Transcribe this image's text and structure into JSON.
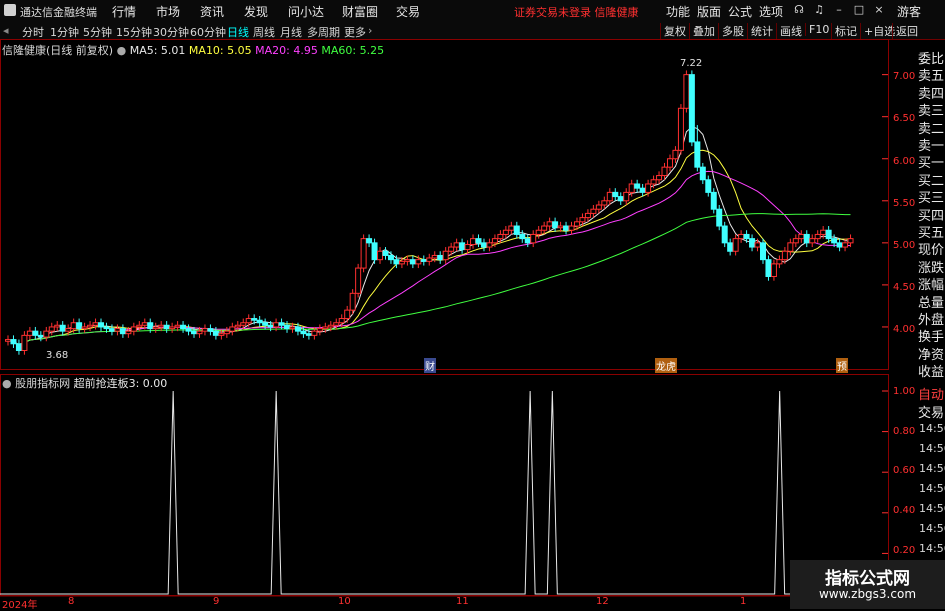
{
  "app": {
    "name": "通达信金融终端"
  },
  "menu": [
    "行情",
    "市场",
    "资讯",
    "发现",
    "问小达",
    "财富圈",
    "交易"
  ],
  "status_alert": "证券交易未登录  信隆健康",
  "top_right": [
    "功能",
    "版面",
    "公式",
    "选项"
  ],
  "guest": "游客",
  "periods": [
    {
      "label": "分时",
      "active": false
    },
    {
      "label": "1分钟",
      "active": false
    },
    {
      "label": "5分钟",
      "active": false
    },
    {
      "label": "15分钟",
      "active": false
    },
    {
      "label": "30分钟",
      "active": false
    },
    {
      "label": "60分钟",
      "active": false
    },
    {
      "label": "日线",
      "active": true
    },
    {
      "label": "周线",
      "active": false
    },
    {
      "label": "月线",
      "active": false
    },
    {
      "label": "多周期",
      "active": false
    },
    {
      "label": "更多",
      "active": false
    }
  ],
  "toolbar_right": [
    "复权",
    "叠加",
    "多股",
    "统计",
    "画线",
    "F10",
    "标记",
    "+自选",
    "返回"
  ],
  "main_chart": {
    "title": "信隆健康(日线 前复权)",
    "ma_labels": [
      {
        "text": "MA5: 5.01",
        "color": "#e8e8e8"
      },
      {
        "text": "MA10: 5.05",
        "color": "#ffff40"
      },
      {
        "text": "MA20: 4.95",
        "color": "#ff40ff"
      },
      {
        "text": "MA60: 5.25",
        "color": "#40ff40"
      }
    ],
    "y_ticks": [
      "7.00",
      "6.50",
      "6.00",
      "5.50",
      "5.00",
      "4.50",
      "4.00"
    ],
    "high_label": "7.22",
    "low_label": "3.68",
    "event_markers": [
      "财",
      "龙虎",
      "预"
    ]
  },
  "indicator": {
    "title": "股朋指标网",
    "name_value": "超前抢连板3: 0.00",
    "y_ticks": [
      "1.00",
      "0.80",
      "0.60",
      "0.40",
      "0.20"
    ]
  },
  "x_axis": [
    "2024年",
    "8",
    "9",
    "10",
    "11",
    "12",
    "1"
  ],
  "right_panel": {
    "labels": [
      "委比",
      "卖五",
      "卖四",
      "卖三",
      "卖二",
      "卖一",
      "买一",
      "买二",
      "买三",
      "买四",
      "买五",
      "现价",
      "涨跌",
      "涨幅",
      "总量",
      "外盘",
      "换手",
      "净资",
      "收益"
    ],
    "bottom": [
      "自动",
      "交易"
    ],
    "times": [
      "14:56",
      "14:56",
      "14:56",
      "14:56",
      "14:56",
      "14:56",
      "14:56",
      "14:56"
    ]
  },
  "watermark": {
    "line1": "指标公式网",
    "line2": "www.zbgs3.com"
  },
  "chart_data": [
    {
      "type": "candlestick",
      "title": "信隆健康(日线 前复权)",
      "ylim": [
        3.5,
        7.4
      ],
      "x_labels": [
        "2024年",
        "8",
        "9",
        "10",
        "11",
        "12",
        "1"
      ],
      "closes": [
        3.85,
        3.8,
        3.72,
        3.9,
        3.95,
        3.9,
        3.88,
        3.95,
        4.0,
        4.02,
        3.95,
        3.98,
        4.05,
        3.98,
        4.0,
        4.02,
        4.05,
        4.0,
        3.98,
        3.95,
        3.98,
        3.92,
        3.95,
        4.0,
        4.02,
        4.05,
        3.98,
        4.0,
        4.02,
        3.98,
        4.0,
        4.02,
        3.98,
        3.95,
        3.92,
        3.95,
        3.98,
        3.95,
        3.9,
        3.92,
        3.95,
        4.0,
        4.02,
        4.05,
        4.1,
        4.08,
        4.05,
        4.02,
        4.0,
        4.05,
        4.02,
        3.98,
        4.0,
        3.95,
        3.92,
        3.9,
        3.95,
        3.98,
        4.0,
        4.02,
        4.05,
        4.1,
        4.2,
        4.4,
        4.7,
        5.05,
        5.0,
        4.8,
        4.9,
        4.85,
        4.8,
        4.75,
        4.78,
        4.8,
        4.75,
        4.8,
        4.78,
        4.82,
        4.85,
        4.8,
        4.9,
        4.95,
        5.0,
        4.92,
        4.98,
        5.05,
        5.0,
        4.95,
        5.0,
        5.05,
        5.1,
        5.15,
        5.2,
        5.1,
        5.05,
        5.0,
        5.1,
        5.15,
        5.2,
        5.25,
        5.18,
        5.2,
        5.15,
        5.2,
        5.25,
        5.3,
        5.35,
        5.4,
        5.45,
        5.5,
        5.6,
        5.55,
        5.5,
        5.6,
        5.7,
        5.65,
        5.6,
        5.7,
        5.75,
        5.8,
        5.9,
        6.0,
        6.1,
        6.6,
        7.0,
        6.2,
        5.9,
        5.75,
        5.6,
        5.4,
        5.2,
        5.0,
        4.9,
        5.05,
        5.1,
        5.05,
        4.95,
        5.0,
        4.8,
        4.6,
        4.75,
        4.8,
        4.9,
        5.0,
        5.05,
        5.1,
        5.0,
        5.05,
        5.1,
        5.15,
        5.05,
        5.0,
        4.95,
        5.0,
        5.05
      ],
      "ma": [
        {
          "name": "MA5",
          "value": 5.01
        },
        {
          "name": "MA10",
          "value": 5.05
        },
        {
          "name": "MA20",
          "value": 4.95
        },
        {
          "name": "MA60",
          "value": 5.25
        }
      ],
      "high": 7.22,
      "low": 3.68
    },
    {
      "type": "line",
      "title": "超前抢连板3",
      "ylim": [
        0,
        1.0
      ],
      "spikes_at_fraction": [
        0.195,
        0.311,
        0.597,
        0.622,
        0.878
      ],
      "spike_value": 1.0,
      "baseline": 0.0
    }
  ]
}
